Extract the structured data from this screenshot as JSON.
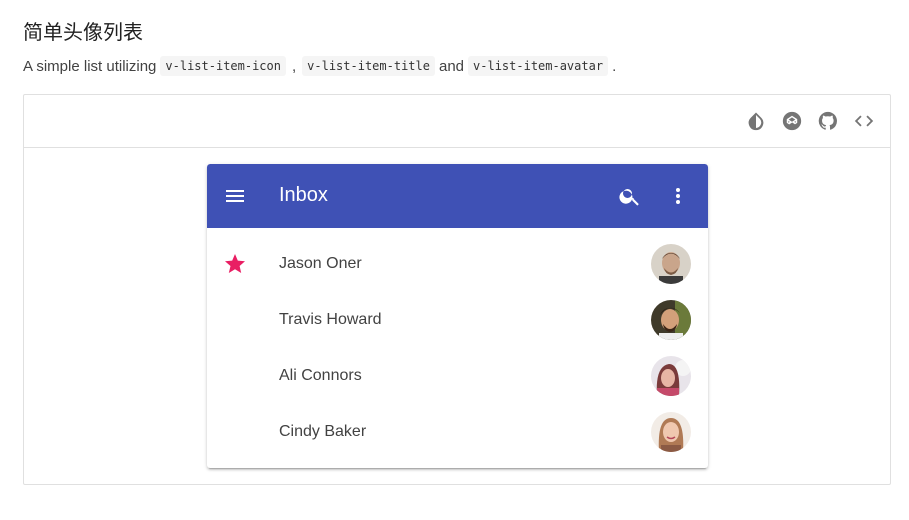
{
  "page": {
    "title": "简单头像列表",
    "description": {
      "prefix": "A simple list utilizing",
      "code1": "v-list-item-icon",
      "sep1": ",",
      "code2": "v-list-item-title",
      "and": "and",
      "code3": "v-list-item-avatar",
      "suffix": "."
    }
  },
  "toolbar": {
    "icons": [
      "invert-colors-icon",
      "codepen-icon",
      "github-icon",
      "code-icon"
    ]
  },
  "inbox": {
    "title": "Inbox",
    "accent_color": "#3f51b5",
    "star_color": "#e91e63",
    "items": [
      {
        "name": "Jason Oner",
        "starred": true
      },
      {
        "name": "Travis Howard",
        "starred": false
      },
      {
        "name": "Ali Connors",
        "starred": false
      },
      {
        "name": "Cindy Baker",
        "starred": false
      }
    ]
  }
}
